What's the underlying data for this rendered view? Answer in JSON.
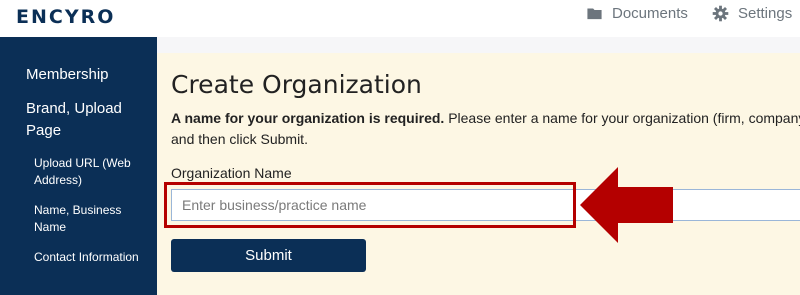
{
  "header": {
    "logo_text": "ENCYRO",
    "nav": [
      {
        "label": "Documents",
        "icon": "folder-icon"
      },
      {
        "label": "Settings",
        "icon": "gear-icon"
      }
    ]
  },
  "sidebar": {
    "items": [
      {
        "label": "Membership"
      },
      {
        "label": "Brand, Upload Page"
      },
      {
        "label": "Upload URL (Web Address)"
      },
      {
        "label": "Name, Business Name"
      },
      {
        "label": "Contact Information"
      }
    ]
  },
  "main": {
    "title": "Create Organization",
    "instructions_bold": "A name for your organization is required.",
    "instructions_text": " Please enter a name for your organization (firm, company or business) and then click Submit.",
    "field_label": "Organization Name",
    "input_placeholder": "Enter business/practice name",
    "input_value": "",
    "submit_label": "Submit"
  },
  "colors": {
    "brand_navy": "#0b2f56",
    "content_bg": "#fdf7e4",
    "highlight_red": "#b40000"
  }
}
